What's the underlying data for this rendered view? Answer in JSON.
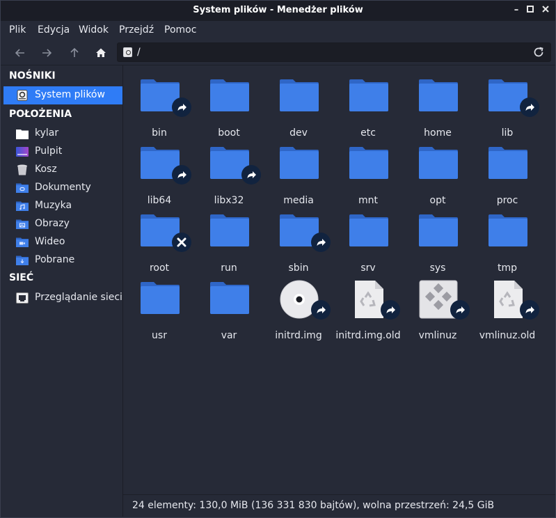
{
  "window": {
    "title": "System plików - Menedżer plików",
    "minimize_glyph": "–",
    "maximize_glyph": "□",
    "close_glyph": "✕"
  },
  "menu": [
    "Plik",
    "Edycja",
    "Widok",
    "Przejdź",
    "Pomoc"
  ],
  "toolbar": {
    "back_icon": "arrow-left-icon",
    "forward_icon": "arrow-right-icon",
    "up_icon": "arrow-up-icon",
    "home_icon": "home-icon",
    "location": "/",
    "reload_icon": "reload-icon"
  },
  "sidebar": {
    "devices_header": "NOŚNIKI",
    "devices": [
      {
        "label": "System plików",
        "icon": "drive-icon",
        "active": true
      }
    ],
    "places_header": "POŁOŻENIA",
    "places": [
      {
        "label": "kylar",
        "icon": "home-folder-icon"
      },
      {
        "label": "Pulpit",
        "icon": "desktop-icon"
      },
      {
        "label": "Kosz",
        "icon": "trash-icon"
      },
      {
        "label": "Dokumenty",
        "icon": "documents-folder-icon"
      },
      {
        "label": "Muzyka",
        "icon": "music-folder-icon"
      },
      {
        "label": "Obrazy",
        "icon": "pictures-folder-icon"
      },
      {
        "label": "Wideo",
        "icon": "video-folder-icon"
      },
      {
        "label": "Pobrane",
        "icon": "downloads-folder-icon"
      }
    ],
    "network_header": "SIEĆ",
    "network": [
      {
        "label": "Przeglądanie sieci",
        "icon": "network-icon"
      }
    ]
  },
  "files": [
    {
      "name": "bin",
      "type": "folder",
      "badge": "link"
    },
    {
      "name": "boot",
      "type": "folder",
      "badge": ""
    },
    {
      "name": "dev",
      "type": "folder",
      "badge": ""
    },
    {
      "name": "etc",
      "type": "folder",
      "badge": ""
    },
    {
      "name": "home",
      "type": "folder",
      "badge": ""
    },
    {
      "name": "lib",
      "type": "folder",
      "badge": "link"
    },
    {
      "name": "lib64",
      "type": "folder",
      "badge": "link"
    },
    {
      "name": "libx32",
      "type": "folder",
      "badge": "link"
    },
    {
      "name": "media",
      "type": "folder",
      "badge": ""
    },
    {
      "name": "mnt",
      "type": "folder",
      "badge": ""
    },
    {
      "name": "opt",
      "type": "folder",
      "badge": ""
    },
    {
      "name": "proc",
      "type": "folder",
      "badge": ""
    },
    {
      "name": "root",
      "type": "folder",
      "badge": "locked"
    },
    {
      "name": "run",
      "type": "folder",
      "badge": ""
    },
    {
      "name": "sbin",
      "type": "folder",
      "badge": "link"
    },
    {
      "name": "srv",
      "type": "folder",
      "badge": ""
    },
    {
      "name": "sys",
      "type": "folder",
      "badge": ""
    },
    {
      "name": "tmp",
      "type": "folder",
      "badge": ""
    },
    {
      "name": "usr",
      "type": "folder",
      "badge": ""
    },
    {
      "name": "var",
      "type": "folder",
      "badge": ""
    },
    {
      "name": "initrd.img",
      "type": "disc",
      "badge": "link"
    },
    {
      "name": "initrd.img.old",
      "type": "archive",
      "badge": "link"
    },
    {
      "name": "vmlinuz",
      "type": "executable",
      "badge": "link"
    },
    {
      "name": "vmlinuz.old",
      "type": "archive",
      "badge": "link"
    }
  ],
  "status": "24 elementy: 130,0 MiB (136 331 830 bajtów), wolna przestrzeń: 24,5 GiB",
  "colors": {
    "accent": "#2f7cf6",
    "folder": "#3f7fe9",
    "folder_tab": "#2f66c7",
    "badge": "#11233f"
  }
}
